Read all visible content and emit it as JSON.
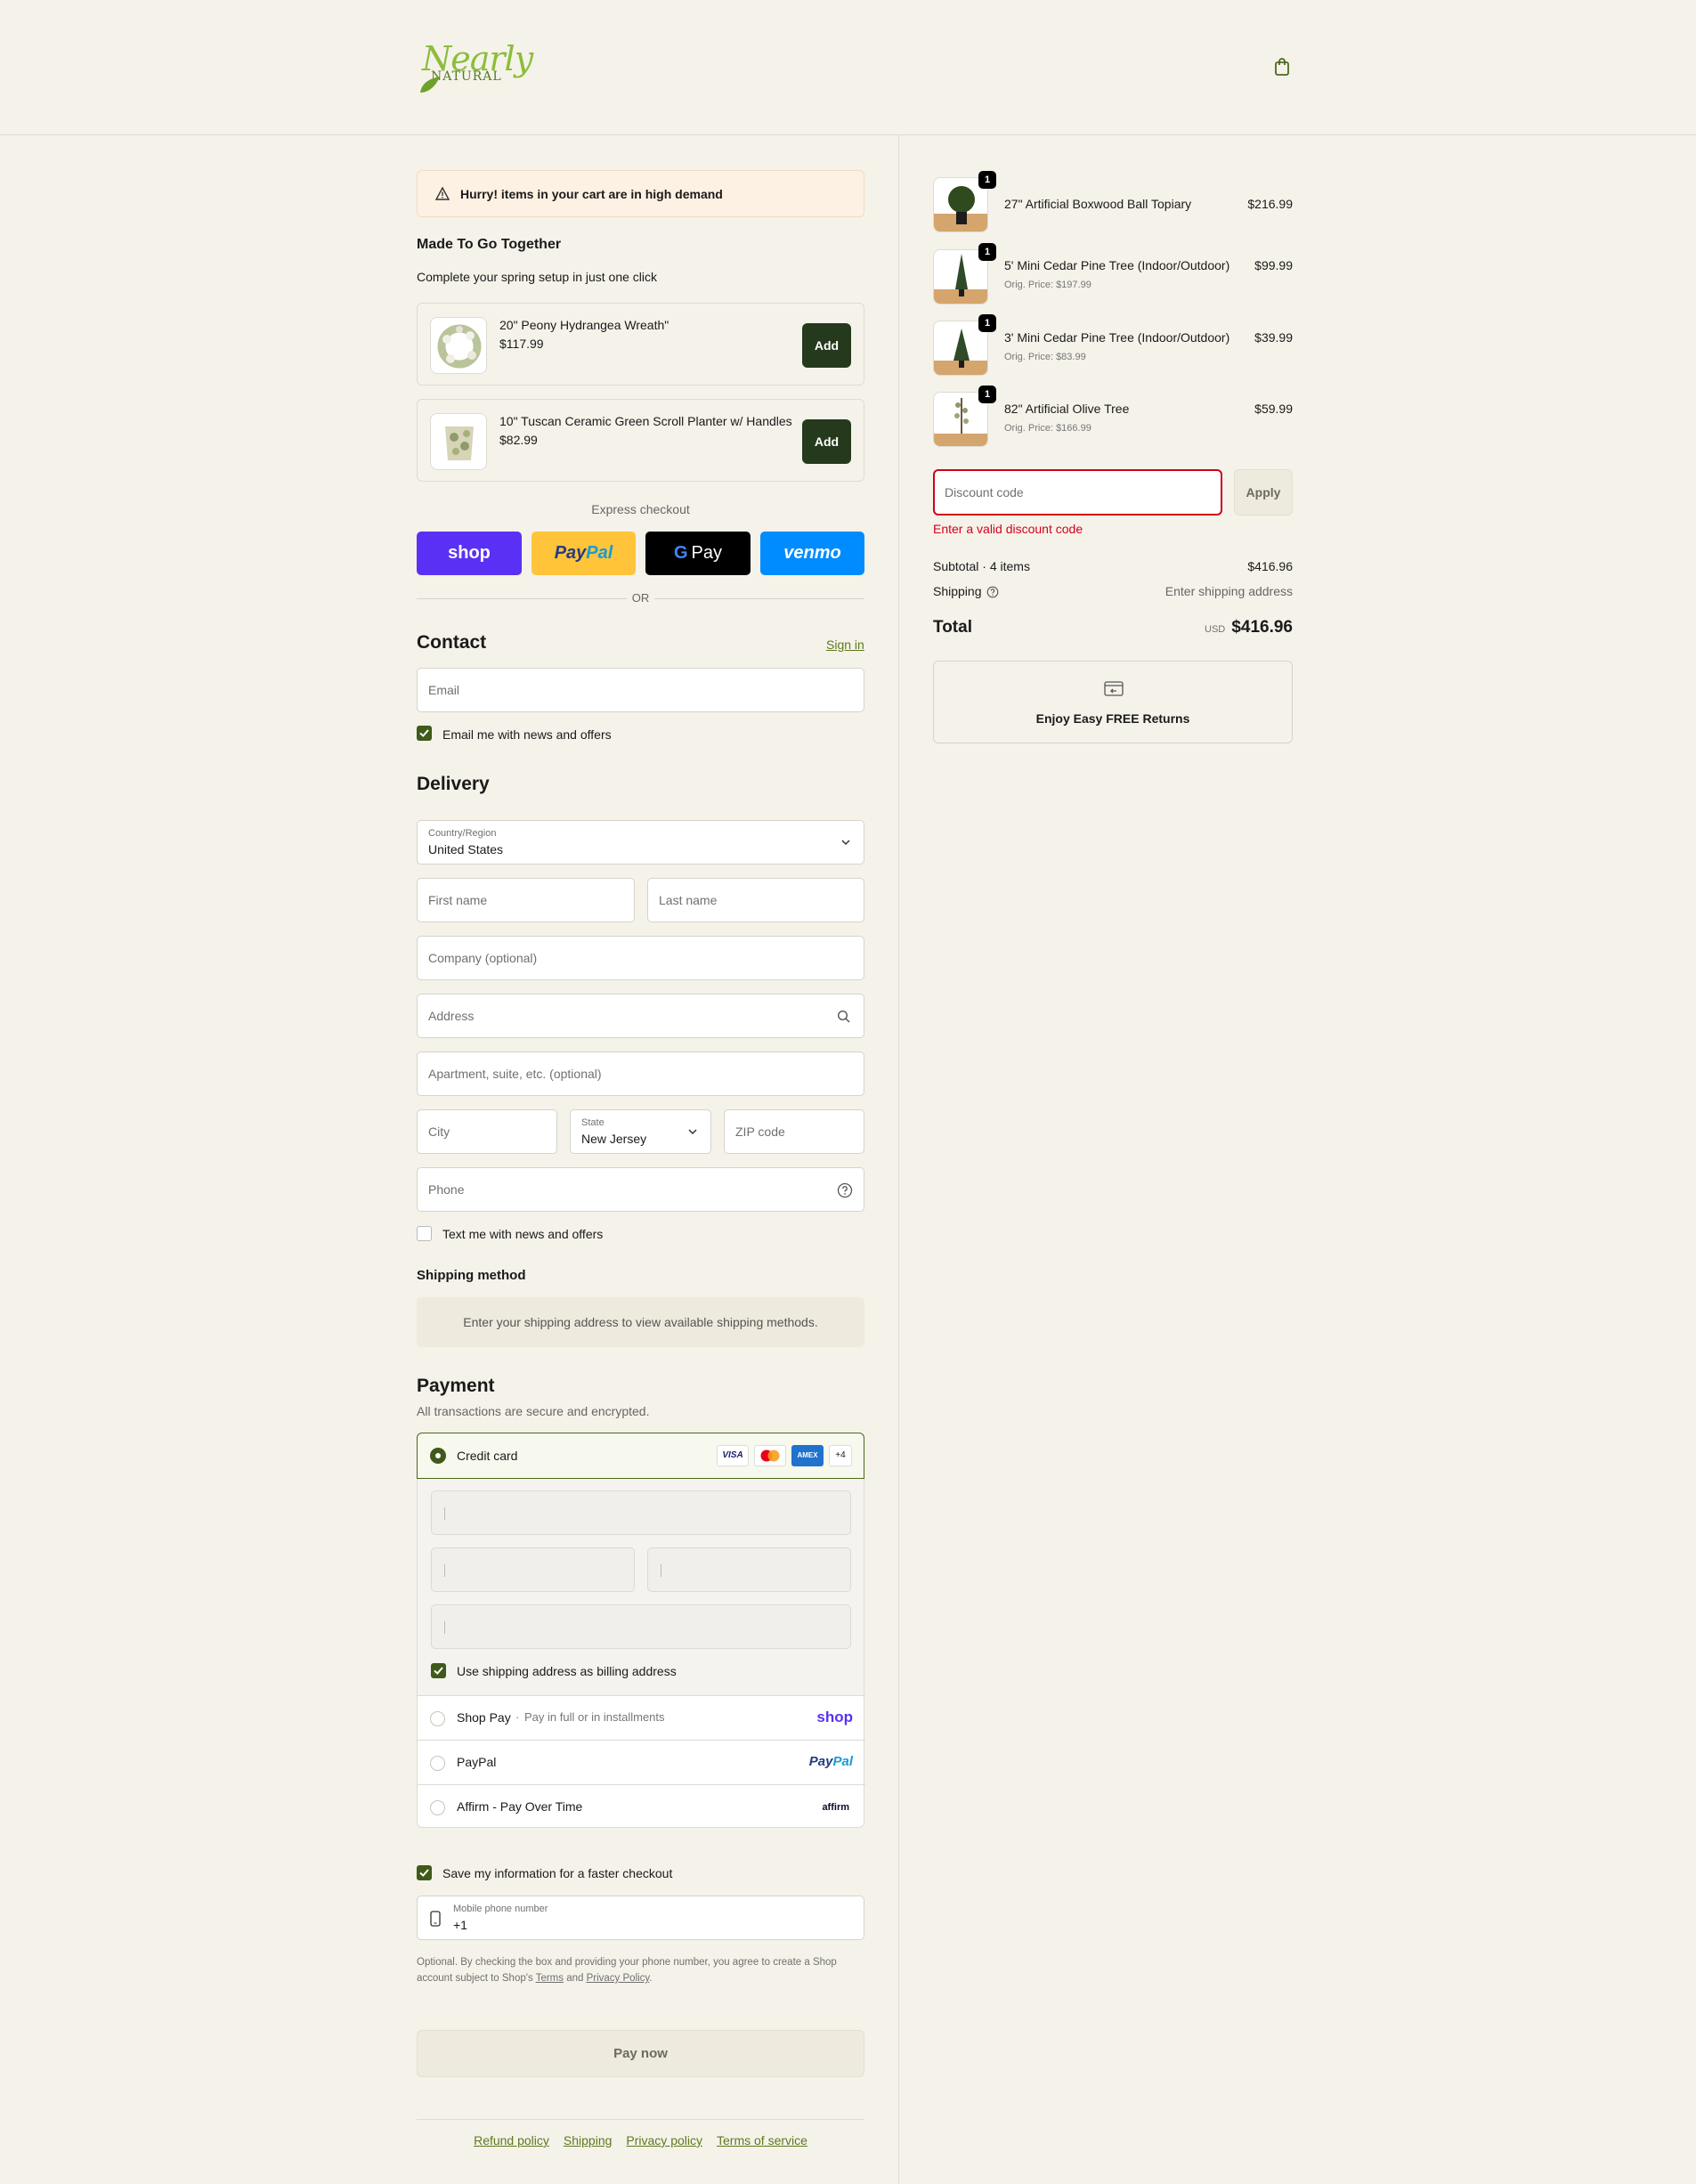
{
  "header": {
    "logo_line1": "Nearly",
    "logo_line2": "NATURAL"
  },
  "banner": {
    "text": "Hurry! items in your cart are in high demand"
  },
  "upsell": {
    "title": "Made To Go Together",
    "subtitle": "Complete your spring setup in just one click",
    "items": [
      {
        "name": "20\" Peony Hydrangea Wreath\"",
        "price": "$117.99",
        "button": "Add"
      },
      {
        "name": "10\" Tuscan Ceramic Green Scroll Planter w/ Handles",
        "price": "$82.99",
        "button": "Add"
      }
    ]
  },
  "express": {
    "label": "Express checkout",
    "shop": "shop",
    "paypal_a": "Pay",
    "paypal_b": "Pal",
    "gpay": "Pay",
    "venmo": "venmo",
    "or": "OR"
  },
  "contact": {
    "title": "Contact",
    "sign_in": "Sign in",
    "email_placeholder": "Email",
    "newsletter": "Email me with news and offers"
  },
  "delivery": {
    "title": "Delivery",
    "country_label": "Country/Region",
    "country_value": "United States",
    "first_name": "First name",
    "last_name": "Last name",
    "company": "Company (optional)",
    "address": "Address",
    "apartment": "Apartment, suite, etc. (optional)",
    "city": "City",
    "state_label": "State",
    "state_value": "New Jersey",
    "zip": "ZIP code",
    "phone": "Phone",
    "sms": "Text me with news and offers"
  },
  "shipping": {
    "title": "Shipping method",
    "notice": "Enter your shipping address to view available shipping methods."
  },
  "payment": {
    "title": "Payment",
    "subtitle": "All transactions are secure and encrypted.",
    "credit_card": "Credit card",
    "card_more": "+4",
    "visa": "VISA",
    "amex": "AMEX",
    "billing_same": "Use shipping address as billing address",
    "shop_pay": "Shop Pay",
    "shop_pay_sub": "Pay in full or in installments",
    "shop_logo": "shop",
    "paypal": "PayPal",
    "paypal_logo_a": "Pay",
    "paypal_logo_b": "Pal",
    "affirm": "Affirm - Pay Over Time",
    "affirm_logo": "affirm"
  },
  "save": {
    "label": "Save my information for a faster checkout",
    "mobile_label": "Mobile phone number",
    "mobile_value": "+1",
    "legal_a": "Optional. By checking the box and providing your phone number, you agree to create a Shop",
    "legal_b": "account subject to Shop's",
    "terms": "Terms",
    "and": "and",
    "privacy": "Privacy Policy",
    "period": "."
  },
  "pay_now": "Pay now",
  "footer": {
    "refund": "Refund policy",
    "shipping": "Shipping",
    "privacy": "Privacy policy",
    "terms": "Terms of service"
  },
  "order": {
    "items": [
      {
        "qty": "1",
        "name": "27\" Artificial Boxwood Ball Topiary",
        "orig": "",
        "price": "$216.99"
      },
      {
        "qty": "1",
        "name": "5' Mini Cedar Pine Tree (Indoor/Outdoor)",
        "orig": "Orig. Price: $197.99",
        "price": "$99.99"
      },
      {
        "qty": "1",
        "name": "3' Mini Cedar Pine Tree (Indoor/Outdoor)",
        "orig": "Orig. Price: $83.99",
        "price": "$39.99"
      },
      {
        "qty": "1",
        "name": "82\" Artificial Olive Tree",
        "orig": "Orig. Price: $166.99",
        "price": "$59.99"
      }
    ],
    "discount_placeholder": "Discount code",
    "apply": "Apply",
    "discount_error": "Enter a valid discount code",
    "subtotal_label": "Subtotal · 4 items",
    "subtotal_value": "$416.96",
    "shipping_label": "Shipping",
    "shipping_value": "Enter shipping address",
    "total_label": "Total",
    "currency": "USD",
    "total_value": "$416.96",
    "returns": "Enjoy Easy FREE Returns"
  },
  "colors": {
    "accent": "#3f5a1a",
    "dark_button": "#253a1d",
    "error": "#d0021b",
    "background": "#f5f2ea"
  }
}
